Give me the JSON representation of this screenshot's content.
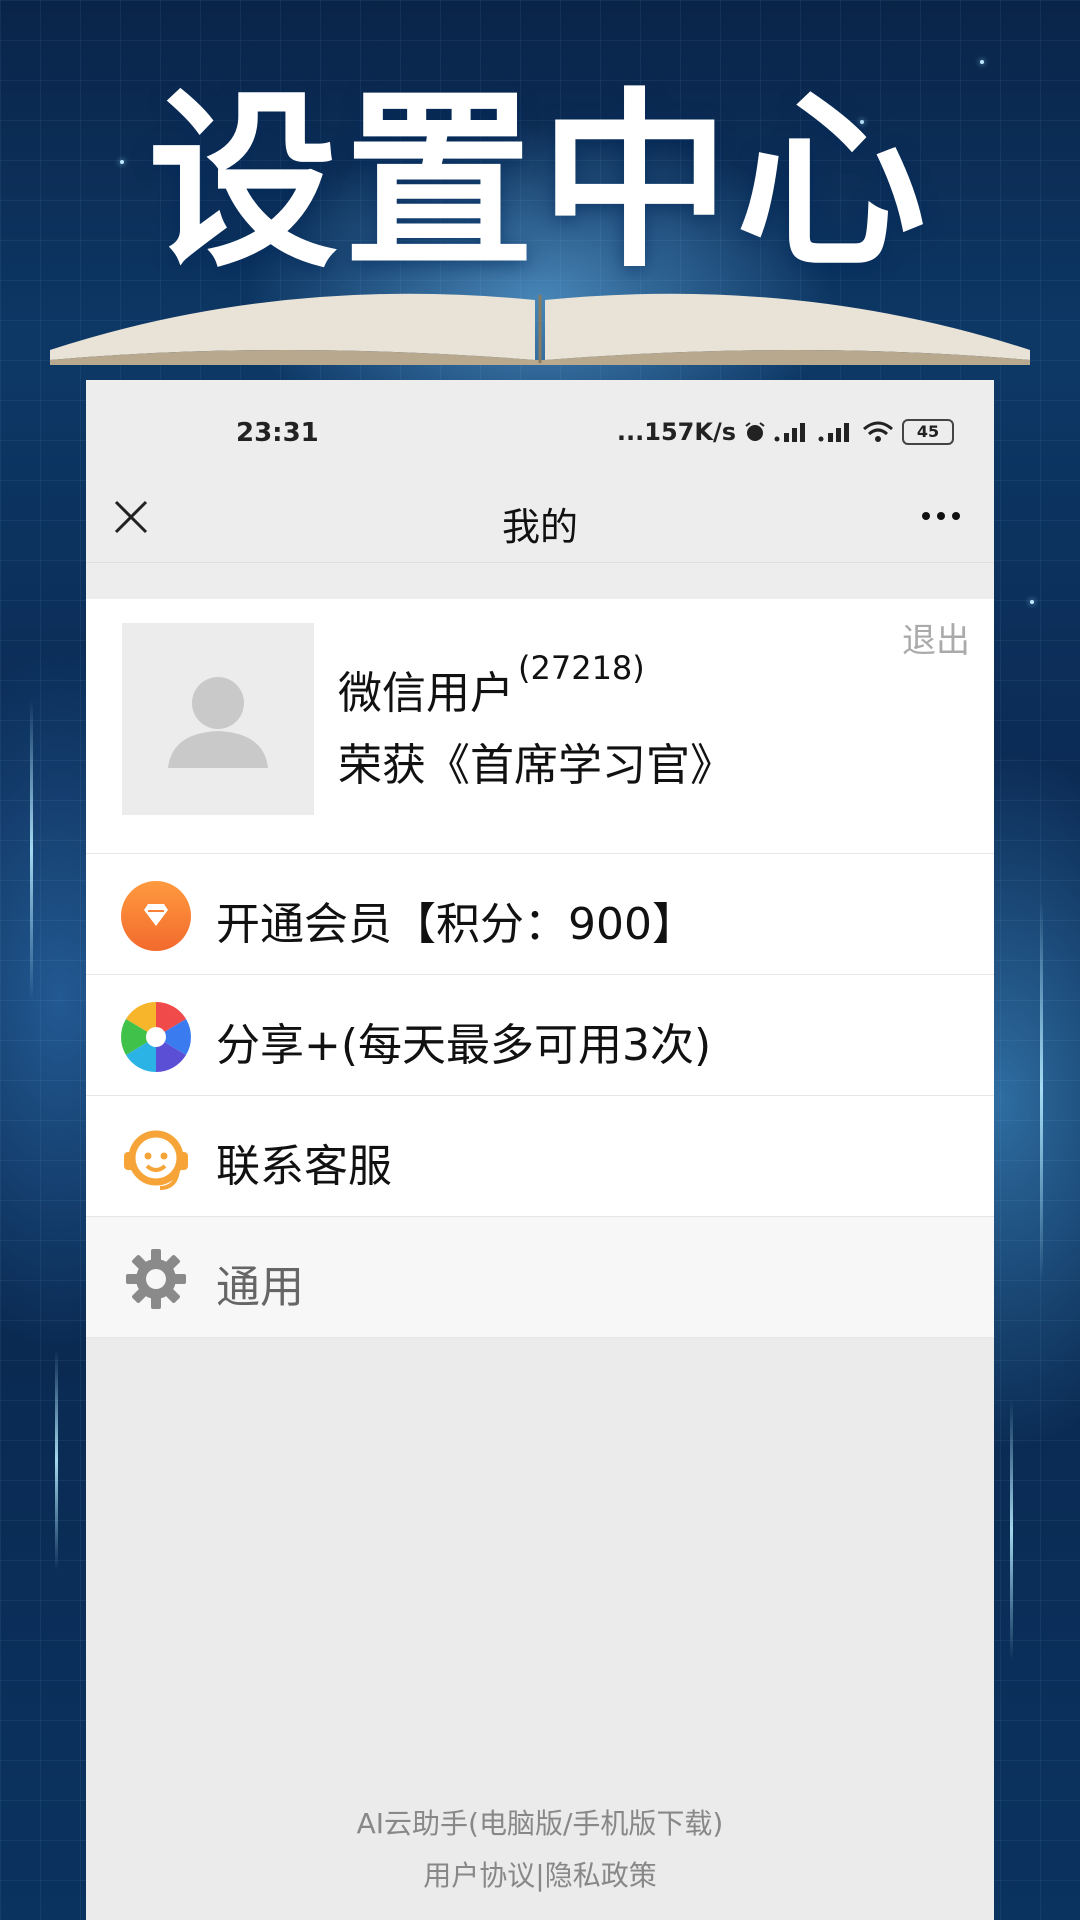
{
  "hero": {
    "title": "设置中心"
  },
  "status_bar": {
    "time": "23:31",
    "network_speed": "...157K/s",
    "battery": "45"
  },
  "nav": {
    "title": "我的",
    "close_icon": "close-icon",
    "more_icon": "more-icon"
  },
  "profile": {
    "logout": "退出",
    "username": "微信用户",
    "user_id": "(27218)",
    "honor": "荣获《首席学习官》"
  },
  "menu": {
    "vip": "开通会员【积分：900】",
    "share": "分享+(每天最多可用3次)",
    "support": "联系客服",
    "general": "通用"
  },
  "footer": {
    "download": "AI云助手(电脑版/手机版下载)",
    "agreement": "用户协议|隐私政策"
  },
  "colors": {
    "vip_orange": "#f7813b",
    "support_orange": "#f6a338",
    "gear_gray": "#8a8a8a"
  }
}
